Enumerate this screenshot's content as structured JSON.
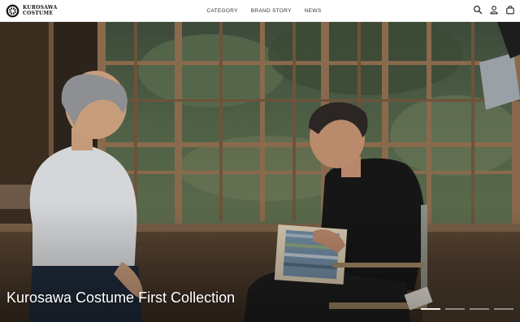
{
  "header": {
    "logo": {
      "line1": "KUROSAWA",
      "line2": "COSTUME"
    },
    "nav": [
      {
        "label": "CATEGORY"
      },
      {
        "label": "BRAND STORY"
      },
      {
        "label": "NEWS"
      }
    ],
    "icons": [
      "search-icon",
      "account-icon",
      "cart-icon"
    ]
  },
  "hero": {
    "title": "Kurosawa Costume First Collection",
    "slides_total": 4,
    "active_slide": 1
  },
  "colors": {
    "header_bg": "#ffffff",
    "nav_text": "#333333",
    "hero_title": "#ffffff"
  }
}
